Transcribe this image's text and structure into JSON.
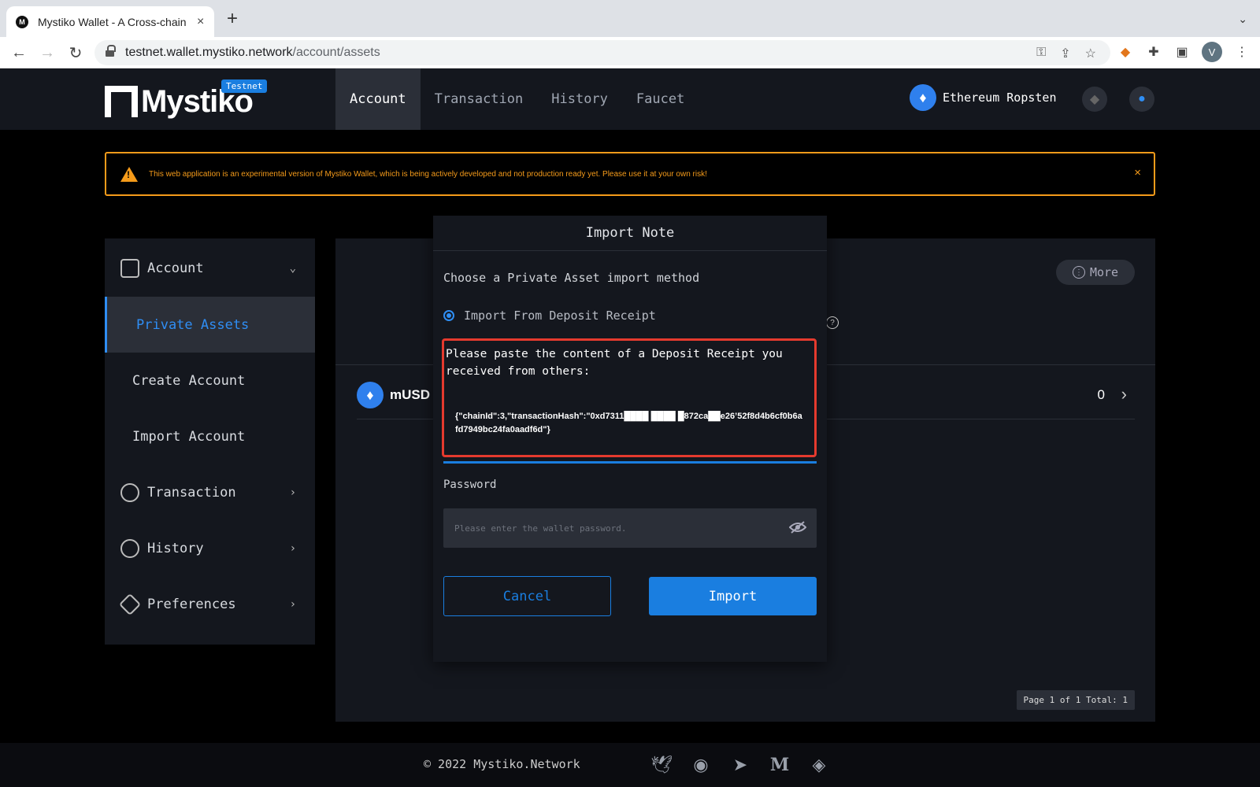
{
  "browser": {
    "tab_title": "Mystiko Wallet - A Cross-chain",
    "url_host": "testnet.wallet.mystiko.network",
    "url_path": "/account/assets",
    "profile_initial": "V"
  },
  "header": {
    "logo_text": "Mystiko",
    "logo_badge": "Testnet",
    "nav": [
      "Account",
      "Transaction",
      "History",
      "Faucet"
    ],
    "active_nav": "Account",
    "network_name": "Ethereum Ropsten"
  },
  "warning": {
    "message": "This web application is an experimental version of Mystiko Wallet, which is being actively developed and not production ready yet. Please use it at your own risk!",
    "close_glyph": "×"
  },
  "sidebar": {
    "account_label": "Account",
    "sub_items": [
      "Private Assets",
      "Create Account",
      "Import Account"
    ],
    "transaction_label": "Transaction",
    "history_label": "History",
    "preferences_label": "Preferences"
  },
  "panel": {
    "more_label": "More",
    "asset_symbol": "mUSD",
    "asset_amount": "0",
    "pager_text": "Page 1 of 1 Total: 1"
  },
  "modal": {
    "title": "Import Note",
    "choose_text": "Choose a Private Asset import method",
    "radio_label": "Import From Deposit Receipt",
    "receipt_label": "Please paste the content of a Deposit Receipt you received from others:",
    "receipt_value": "{\"chainId\":3,\"transactionHash\":\"0xd7311████ ████ █872ca██e26’52f8d4b6cf0b6afd7949bc24fa0aadf6d\"}",
    "password_label": "Password",
    "password_placeholder": "Please enter the wallet password.",
    "cancel_label": "Cancel",
    "import_label": "Import"
  },
  "footer": {
    "copyright": "© 2022 Mystiko.Network",
    "socials": [
      "twitter-icon",
      "github-icon",
      "telegram-icon",
      "medium-icon",
      "discord-icon"
    ]
  },
  "colors": {
    "accent": "#1a7ee0",
    "warning": "#f59b1a",
    "highlight_box": "#e53a2e",
    "panel_bg": "#14171e"
  }
}
